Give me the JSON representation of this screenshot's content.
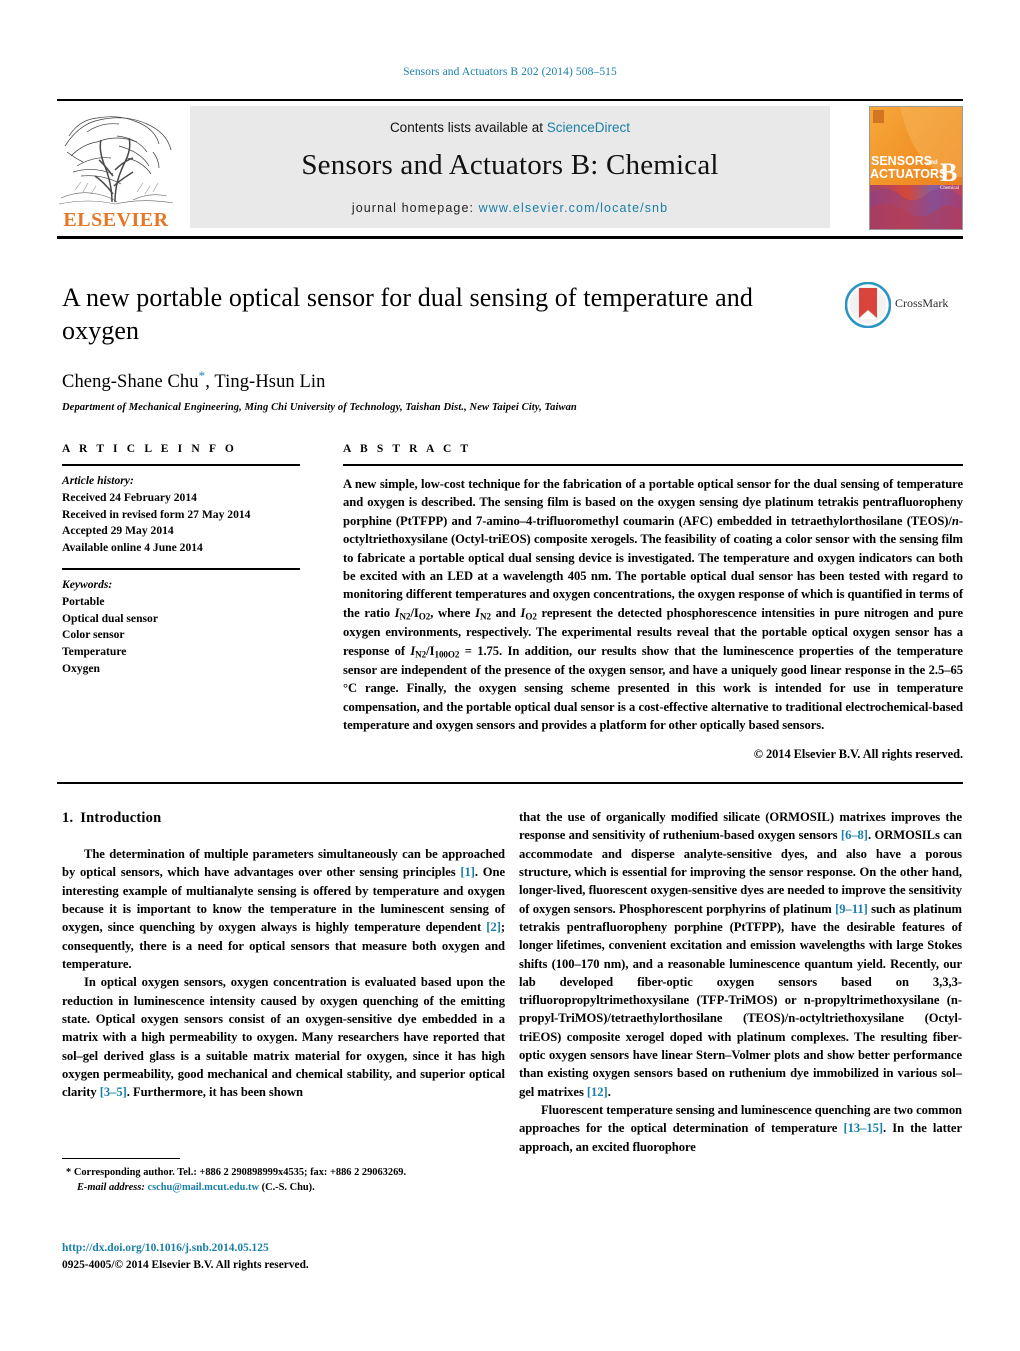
{
  "running_head": "Sensors and Actuators B 202 (2014) 508–515",
  "header": {
    "contents_prefix": "Contents lists available at ",
    "sciencedirect": "ScienceDirect",
    "journal_title": "Sensors and Actuators B: Chemical",
    "homepage_prefix": "journal homepage: ",
    "homepage_url": "www.elsevier.com/locate/snb",
    "publisher": "ELSEVIER",
    "cover_line1": "SENSORS",
    "cover_and": "and",
    "cover_line2": "ACTUATORS",
    "cover_letter": "B",
    "cover_sub": "Chemical"
  },
  "title": "A new portable optical sensor for dual sensing of temperature and oxygen",
  "authors": "Cheng-Shane Chu",
  "authors_rest": ", Ting-Hsun Lin",
  "author_star": "*",
  "affiliation": "Department of Mechanical Engineering, Ming Chi University of Technology, Taishan Dist., New Taipei City, Taiwan",
  "crossmark_label": "CrossMark",
  "article_info": {
    "heading": "A R T I C L E   I N F O",
    "history_label": "Article history:",
    "history": [
      "Received 24 February 2014",
      "Received in revised form 27 May 2014",
      "Accepted 29 May 2014",
      "Available online 4 June 2014"
    ],
    "keywords_label": "Keywords:",
    "keywords": [
      "Portable",
      "Optical dual sensor",
      "Color sensor",
      "Temperature",
      "Oxygen"
    ]
  },
  "abstract": {
    "heading": "A B S T R A C T",
    "text_part1": "A new simple, low-cost technique for the fabrication of a portable optical sensor for the dual sensing of temperature and oxygen is described. The sensing film is based on the oxygen sensing dye platinum tetrakis pentrafluoropheny porphine (PtTFPP) and 7-amino–4-trifluoromethyl coumarin (AFC) embedded in tetraethylorthosilane (TEOS)/",
    "text_italic1": "n",
    "text_part2": "-octyltriethoxysilane (Octyl-triEOS) composite xerogels. The feasibility of coating a color sensor with the sensing film to fabricate a portable optical dual sensing device is investigated. The temperature and oxygen indicators can both be excited with an LED at a wavelength 405 nm. The portable optical dual sensor has been tested with regard to monitoring different temperatures and oxygen concentrations, the oxygen response of which is quantified in terms of the ratio ",
    "ratio1_base": "I",
    "ratio1_sub": "N2",
    "ratio1_sep": "/I",
    "ratio1_sub2": "O2",
    "text_part3": ", where ",
    "ratio2_base": "I",
    "ratio2_sub": "N2",
    "text_part4": " and ",
    "ratio3_base": "I",
    "ratio3_sub": "O2",
    "text_part5": " represent the detected phosphorescence intensities in pure nitrogen and pure oxygen environments, respectively. The experimental results reveal that the portable optical oxygen sensor has a response of ",
    "ratio4_base": "I",
    "ratio4_sub": "N2",
    "ratio4_sep": "/I",
    "ratio4_sub2": "100O2",
    "ratio4_value": " = 1.75",
    "text_part6": ". In addition, our results show that the luminescence properties of the temperature sensor are independent of the presence of the oxygen sensor, and have a uniquely good linear response in the 2.5–65 °C range. Finally, the oxygen sensing scheme presented in this work is intended for use in temperature compensation, and the portable optical dual sensor is a cost-effective alternative to traditional electrochemical-based temperature and oxygen sensors and provides a platform for other optically based sensors.",
    "copyright": "© 2014 Elsevier B.V. All rights reserved."
  },
  "intro": {
    "heading_num": "1.",
    "heading_text": "Introduction",
    "left_p1_a": "The determination of multiple parameters simultaneously can be approached by optical sensors, which have advantages over other sensing principles ",
    "left_p1_ref1": "[1]",
    "left_p1_b": ". One interesting example of multianalyte sensing is offered by temperature and oxygen because it is important to know the temperature in the luminescent sensing of oxygen, since quenching by oxygen always is highly temperature dependent ",
    "left_p1_ref2": "[2]",
    "left_p1_c": "; consequently, there is a need for optical sensors that measure both oxygen and temperature.",
    "left_p2_a": "In optical oxygen sensors, oxygen concentration is evaluated based upon the reduction in luminescence intensity caused by oxygen quenching of the emitting state. Optical oxygen sensors consist of an oxygen-sensitive dye embedded in a matrix with a high permeability to oxygen. Many researchers have reported that sol–gel derived glass is a suitable matrix material for oxygen, since it has high oxygen permeability, good mechanical and chemical stability, and superior optical clarity ",
    "left_p2_ref": "[3–5]",
    "left_p2_b": ". Furthermore, it has been shown",
    "right_p1_a": "that the use of organically modified silicate (ORMOSIL) matrixes improves the response and sensitivity of ruthenium-based oxygen sensors ",
    "right_p1_ref1": "[6–8]",
    "right_p1_b": ". ORMOSILs can accommodate and disperse analyte-sensitive dyes, and also have a porous structure, which is essential for improving the sensor response. On the other hand, longer-lived, fluorescent oxygen-sensitive dyes are needed to improve the sensitivity of oxygen sensors. Phosphorescent porphyrins of platinum ",
    "right_p1_ref2": "[9–11]",
    "right_p1_c": " such as platinum tetrakis pentrafluoropheny porphine (PtTFPP), have the desirable features of longer lifetimes, convenient excitation and emission wavelengths with large Stokes shifts (100–170 nm), and a reasonable luminescence quantum yield. Recently, our lab developed fiber-optic oxygen sensors based on 3,3,3-trifluoropropyltrimethoxysilane (TFP-TriMOS) or n-propyltrimethoxysilane (n-propyl-TriMOS)/tetraethylorthosilane (TEOS)/n-octyltriethoxysilane (Octyl-triEOS) composite xerogel doped with platinum complexes. The resulting fiber-optic oxygen sensors have linear Stern–Volmer plots and show better performance than existing oxygen sensors based on ruthenium dye immobilized in various sol–gel matrixes ",
    "right_p1_ref3": "[12]",
    "right_p1_d": ".",
    "right_p2_a": "Fluorescent temperature sensing and luminescence quenching are two common approaches for the optical determination of temperature ",
    "right_p2_ref": "[13–15]",
    "right_p2_b": ". In the latter approach, an excited fluorophore"
  },
  "footnote": {
    "star": "*",
    "line1": "Corresponding author. Tel.: +886 2 290898999x4535; fax: +886 2 29063269.",
    "email_label": "E-mail address:",
    "email": "cschu@mail.mcut.edu.tw",
    "email_suffix": " (C.-S. Chu)."
  },
  "doi": {
    "url": "http://dx.doi.org/10.1016/j.snb.2014.05.125",
    "issn_line": "0925-4005/© 2014 Elsevier B.V. All rights reserved."
  },
  "colors": {
    "link": "#1a7fa8",
    "elsevier_orange": "#E77625",
    "band_gray": "#e9e9e9"
  }
}
